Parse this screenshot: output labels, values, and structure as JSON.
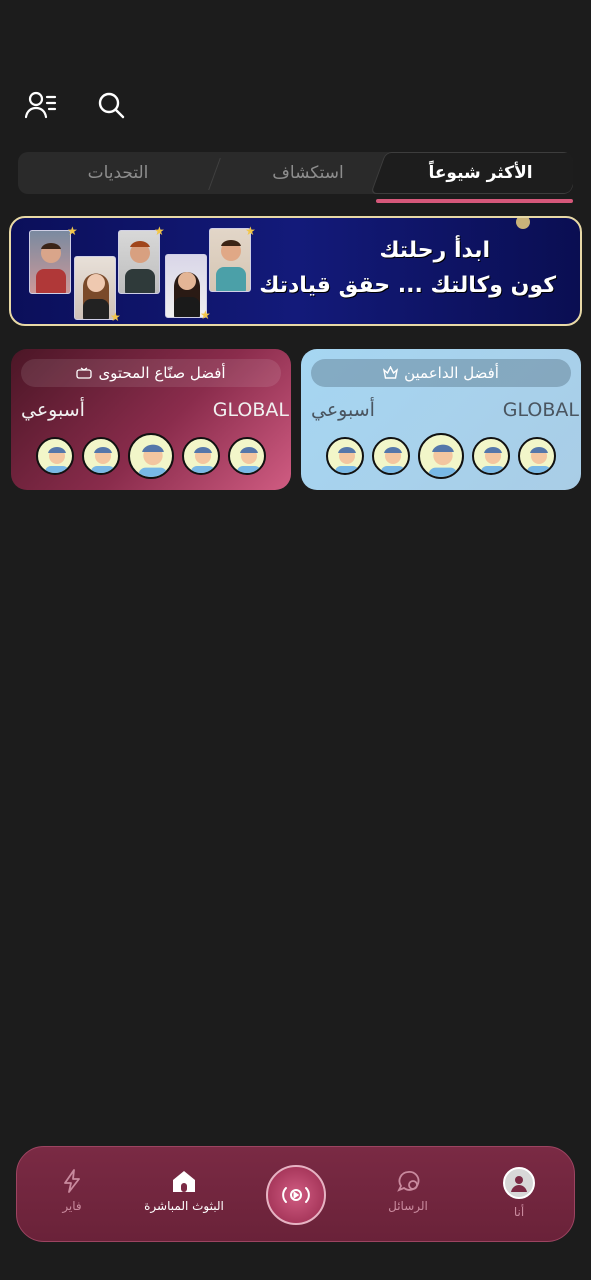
{
  "topbar": {
    "search_icon": "search-icon",
    "people_icon": "user-list-icon"
  },
  "tabs": [
    {
      "label": "الأكثر شيوعاً",
      "active": true
    },
    {
      "label": "استكشاف",
      "active": false
    },
    {
      "label": "التحديات",
      "active": false
    }
  ],
  "banner": {
    "line1": "ابدأ رحلتك",
    "line2": "كون وكالتك ... حقق قيادتك"
  },
  "supporters_card": {
    "title": "أفضل الداعمين",
    "region": "GLOBAL",
    "period": "أسبوعي"
  },
  "creators_card": {
    "title": "أفضل صنّاع المحتوى",
    "region": "GLOBAL",
    "period": "أسبوعي"
  },
  "nav": {
    "me": "أنا",
    "messages": "الرسائل",
    "live": "البثوث المباشرة",
    "fire": "فاير"
  },
  "colors": {
    "accent": "#d6587a",
    "nav_bg": "#7a2a44",
    "bg": "#1c1c1c"
  }
}
